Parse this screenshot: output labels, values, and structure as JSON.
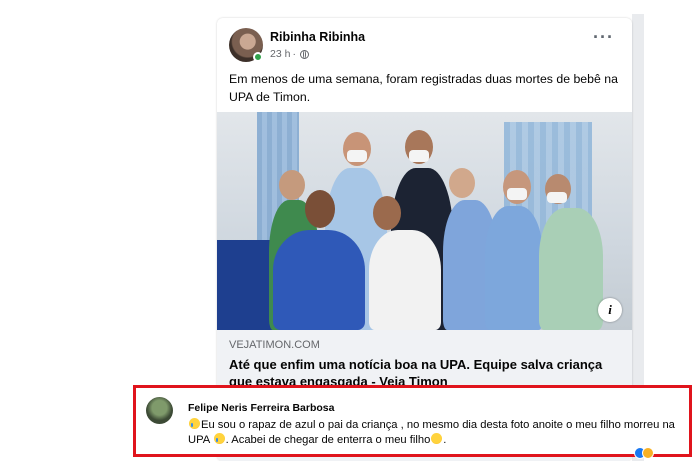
{
  "post": {
    "author": "Ribinha Ribinha",
    "time": "23 h",
    "separator": "·",
    "menu_icon": "more-horizontal-icon",
    "text": "Em menos de uma semana, foram registradas duas mortes de bebê na UPA de Timon."
  },
  "link_preview": {
    "domain": "VEJATIMON.COM",
    "title": "Até que enfim uma notícia boa na UPA. Equipe salva criança que estava engasgada - Veja Timon",
    "info_label": "i"
  },
  "comment": {
    "author": "Felipe Neris Ferreira Barbosa",
    "text_part1": "Eu sou o rapaz de azul o pai da criança , no mesmo dia desta foto anoite o meu filho morreu na UPA ",
    "text_part2": ". Acabei de chegar de enterra o meu filho",
    "text_end": "."
  },
  "colors": {
    "highlight_border": "#e0141c",
    "online": "#31a24c",
    "link_bg": "#f0f2f5",
    "secondary_text": "#65676b"
  }
}
